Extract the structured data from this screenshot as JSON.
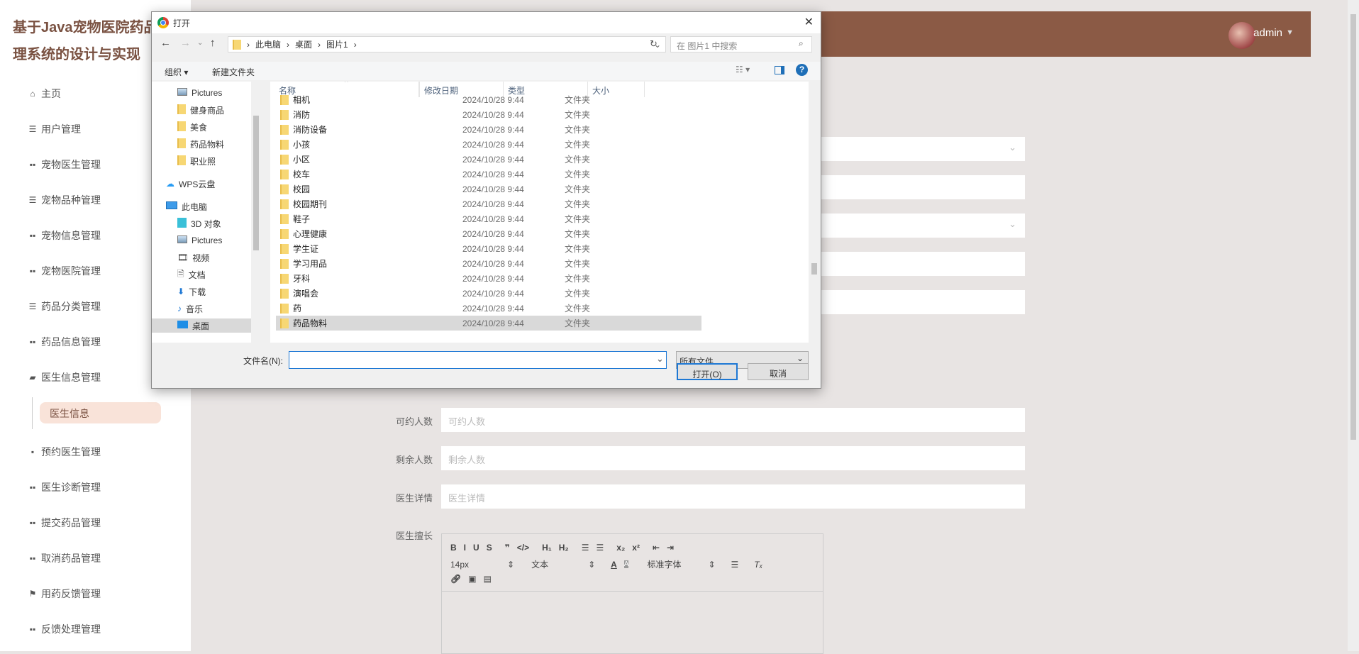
{
  "app": {
    "title_line1": "基于Java宠物医院药品",
    "title_line2": "理系统的设计与实现",
    "user": "admin",
    "header_color": "#8b5a45"
  },
  "sidebar": {
    "items": [
      {
        "label": "主页",
        "icon": "home-icon"
      },
      {
        "label": "用户管理",
        "icon": "sliders-icon"
      },
      {
        "label": "宠物医生管理",
        "icon": "grid-icon"
      },
      {
        "label": "宠物品种管理",
        "icon": "list-icon"
      },
      {
        "label": "宠物信息管理",
        "icon": "grid-icon"
      },
      {
        "label": "宠物医院管理",
        "icon": "grid-icon"
      },
      {
        "label": "药品分类管理",
        "icon": "list-icon"
      },
      {
        "label": "药品信息管理",
        "icon": "grid-icon"
      },
      {
        "label": "医生信息管理",
        "icon": "wallet-icon"
      },
      {
        "label": "预约医生管理",
        "icon": "chat-icon"
      },
      {
        "label": "医生诊断管理",
        "icon": "grid-icon"
      },
      {
        "label": "提交药品管理",
        "icon": "grid-icon"
      },
      {
        "label": "取消药品管理",
        "icon": "grid-icon"
      },
      {
        "label": "用药反馈管理",
        "icon": "flag-icon"
      },
      {
        "label": "反馈处理管理",
        "icon": "grid-icon"
      }
    ],
    "sub_item": "医生信息"
  },
  "form": {
    "available": {
      "label": "可约人数",
      "placeholder": "可约人数"
    },
    "remaining": {
      "label": "剩余人数",
      "placeholder": "剩余人数"
    },
    "detail": {
      "label": "医生详情",
      "placeholder": "医生详情"
    },
    "specialty": {
      "label": "医生擅长"
    },
    "editor": {
      "row1": [
        "B",
        "I",
        "U",
        "S",
        "❞",
        "</>",
        "H₁",
        "H₂",
        "☰",
        "☰",
        "x₂",
        "x²",
        "⇤",
        "⇥"
      ],
      "font_size": "14px",
      "header": "文本",
      "font": "标准字体"
    }
  },
  "dialog": {
    "title": "打开",
    "crumbs": [
      "此电脑",
      "桌面",
      "图片1"
    ],
    "search_placeholder": "在 图片1 中搜索",
    "organize": "组织 ▾",
    "new_folder": "新建文件夹",
    "nav": [
      {
        "label": "Pictures",
        "k": "pic"
      },
      {
        "label": "健身商品",
        "k": "f"
      },
      {
        "label": "美食",
        "k": "f"
      },
      {
        "label": "药品物料",
        "k": "f"
      },
      {
        "label": "职业照",
        "k": "f"
      },
      {
        "label": "WPS云盘",
        "k": "cloud"
      },
      {
        "label": "此电脑",
        "k": "pc"
      },
      {
        "label": "3D 对象",
        "k": "3d"
      },
      {
        "label": "Pictures",
        "k": "pic"
      },
      {
        "label": "视频",
        "k": "video"
      },
      {
        "label": "文档",
        "k": "doc"
      },
      {
        "label": "下载",
        "k": "dl"
      },
      {
        "label": "音乐",
        "k": "music"
      },
      {
        "label": "桌面",
        "k": "desk"
      }
    ],
    "columns": [
      "名称",
      "修改日期",
      "类型",
      "大小"
    ],
    "files": [
      {
        "name": "相机",
        "date": "2024/10/28 9:44",
        "type": "文件夹"
      },
      {
        "name": "消防",
        "date": "2024/10/28 9:44",
        "type": "文件夹"
      },
      {
        "name": "消防设备",
        "date": "2024/10/28 9:44",
        "type": "文件夹"
      },
      {
        "name": "小孩",
        "date": "2024/10/28 9:44",
        "type": "文件夹"
      },
      {
        "name": "小区",
        "date": "2024/10/28 9:44",
        "type": "文件夹"
      },
      {
        "name": "校车",
        "date": "2024/10/28 9:44",
        "type": "文件夹"
      },
      {
        "name": "校园",
        "date": "2024/10/28 9:44",
        "type": "文件夹"
      },
      {
        "name": "校园期刊",
        "date": "2024/10/28 9:44",
        "type": "文件夹"
      },
      {
        "name": "鞋子",
        "date": "2024/10/28 9:44",
        "type": "文件夹"
      },
      {
        "name": "心理健康",
        "date": "2024/10/28 9:44",
        "type": "文件夹"
      },
      {
        "name": "学生证",
        "date": "2024/10/28 9:44",
        "type": "文件夹"
      },
      {
        "name": "学习用品",
        "date": "2024/10/28 9:44",
        "type": "文件夹"
      },
      {
        "name": "牙科",
        "date": "2024/10/28 9:44",
        "type": "文件夹"
      },
      {
        "name": "演唱会",
        "date": "2024/10/28 9:44",
        "type": "文件夹"
      },
      {
        "name": "药",
        "date": "2024/10/28 9:44",
        "type": "文件夹"
      },
      {
        "name": "药品物料",
        "date": "2024/10/28 9:44",
        "type": "文件夹"
      }
    ],
    "filename_label": "文件名(N):",
    "filename_value": "",
    "filter": "所有文件",
    "open": "打开(O)",
    "cancel": "取消"
  }
}
